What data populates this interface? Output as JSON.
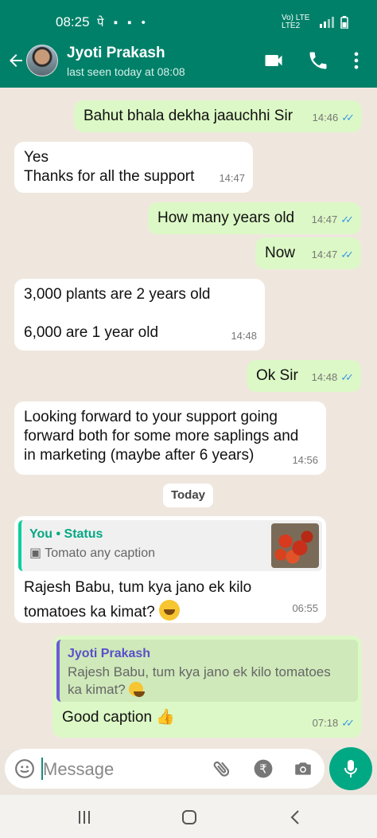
{
  "status_bar": {
    "time": "08:25",
    "icons": "पे ▪ ▪ •",
    "network": "Vo) LTE LTE2"
  },
  "header": {
    "contact_name": "Jyoti Prakash",
    "last_seen": "last seen today at 08:08"
  },
  "messages": [
    {
      "dir": "out",
      "text": "Bahut bhala dekha jaauchhi Sir",
      "time": "14:46"
    },
    {
      "dir": "in",
      "lines": [
        "Yes",
        "Thanks for all the support"
      ],
      "time": "14:47"
    },
    {
      "dir": "out",
      "text": "How many years old",
      "time": "14:47"
    },
    {
      "dir": "out",
      "text": "Now",
      "time": "14:47"
    },
    {
      "dir": "in",
      "lines": [
        "3,000 plants are 2 years old",
        "6,000 are 1 year old"
      ],
      "time": "14:48"
    },
    {
      "dir": "out",
      "text": "Ok Sir",
      "time": "14:48"
    },
    {
      "dir": "in",
      "lines": [
        "Looking forward to your support going",
        "forward both for some more saplings and",
        "in marketing (maybe after 6 years)"
      ],
      "time": "14:56"
    },
    {
      "dir": "in",
      "quote": {
        "title": "You • Status",
        "subtitle": "Tomato any caption"
      },
      "lines": [
        "Rajesh Babu, tum kya jano ek kilo",
        "tomatoes ka kimat?"
      ],
      "time": "06:55"
    },
    {
      "dir": "out",
      "quote": {
        "title": "Jyoti Prakash",
        "lines": [
          "Rajesh Babu, tum kya jano ek kilo tomatoes",
          "ka kimat?"
        ]
      },
      "text": "Good caption",
      "time": "07:18"
    }
  ],
  "day_divider": "Today",
  "composer": {
    "placeholder": "Message"
  },
  "icons": {
    "back": "back-arrow-icon",
    "video": "video-call-icon",
    "call": "phone-icon",
    "menu": "more-vert-icon",
    "emoji": "emoji-icon",
    "attach": "attach-icon",
    "rupee": "rupee-payment-icon",
    "camera": "camera-icon",
    "mic": "mic-icon"
  },
  "colors": {
    "header": "#008069",
    "outgoing": "#dcf8c6",
    "incoming": "#ffffff",
    "tick": "#3b97e4",
    "accent": "#00a884"
  }
}
